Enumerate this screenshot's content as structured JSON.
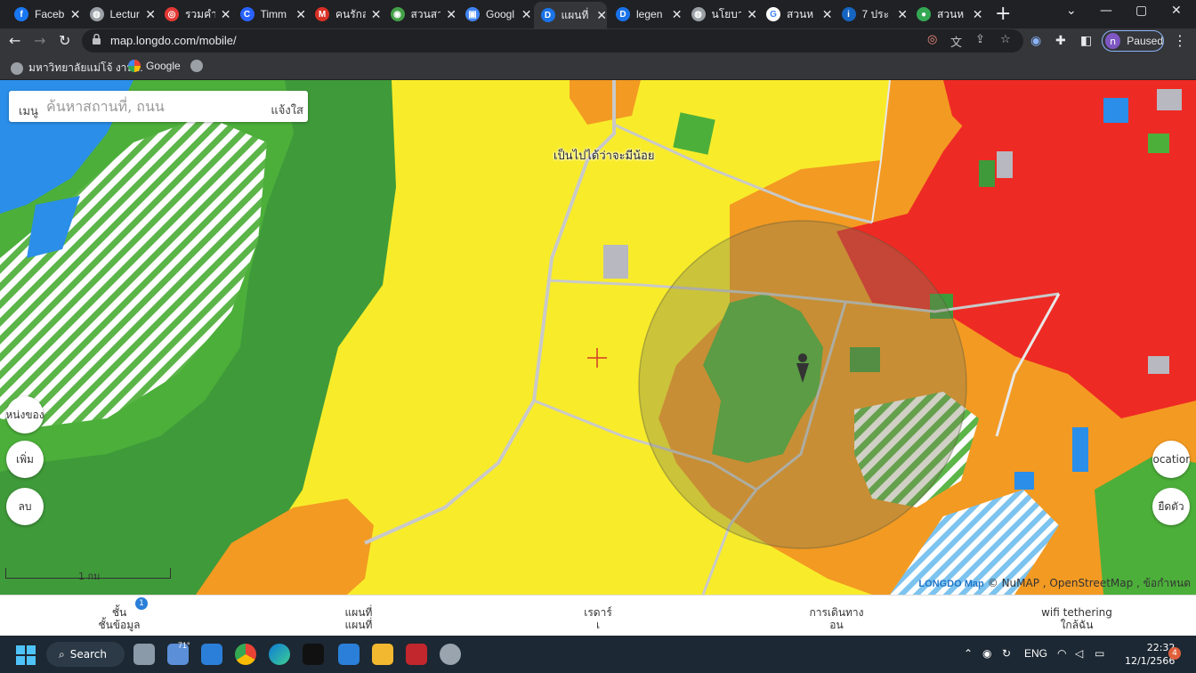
{
  "tabs": [
    {
      "title": "Faceb",
      "favicon": "facebook-icon",
      "color": "#1877f2",
      "glyph": "f"
    },
    {
      "title": "Lectur",
      "favicon": "globe-icon",
      "color": "#9aa0a6",
      "glyph": "◍"
    },
    {
      "title": "รวมคำ",
      "favicon": "target-icon",
      "color": "#e53935",
      "glyph": "◎"
    },
    {
      "title": "Timm",
      "favicon": "timm-icon",
      "color": "#2962ff",
      "glyph": "C"
    },
    {
      "title": "คนรักส",
      "favicon": "gmail-icon",
      "color": "#d93025",
      "glyph": "M"
    },
    {
      "title": "สวนสา",
      "favicon": "site-icon",
      "color": "#43a047",
      "glyph": "◉"
    },
    {
      "title": "Googl",
      "favicon": "google-slides-icon",
      "color": "#4285f4",
      "glyph": "▣"
    },
    {
      "title": "แผนที่",
      "favicon": "doc-icon",
      "color": "#1a73e8",
      "glyph": "D"
    },
    {
      "title": "legen",
      "favicon": "doc-icon",
      "color": "#1a73e8",
      "glyph": "D"
    },
    {
      "title": "นโยบาย",
      "favicon": "globe-icon",
      "color": "#9aa0a6",
      "glyph": "◍"
    },
    {
      "title": "สวนห",
      "favicon": "google-icon",
      "color": "#ffffff",
      "glyph": "G"
    },
    {
      "title": "7 ประ",
      "favicon": "info-icon",
      "color": "#1565c0",
      "glyph": "i"
    },
    {
      "title": "สวนห",
      "favicon": "maps-pin-icon",
      "color": "#34a853",
      "glyph": "●"
    }
  ],
  "active_tab_index": 7,
  "address": {
    "url": "map.longdo.com/mobile/"
  },
  "bookmarks": [
    {
      "label": "มหาวิทยาลัยแม่โจ้ งาน...",
      "icon": "globe-icon"
    },
    {
      "label": "Google",
      "icon": "google-icon"
    },
    {
      "label": "",
      "icon": "globe-icon"
    }
  ],
  "profile": {
    "initial": "n",
    "label": "Paused"
  },
  "map": {
    "search_menu": "เมนู",
    "search_placeholder": "ค้นหาสถานที่, ถนน",
    "report_label": "แจ้งใส",
    "place_label": "เป็นไปได้ว่าจะมีน้อย",
    "left_buttons": [
      "หน่งของ",
      "เพิ่ม",
      "ลบ"
    ],
    "right_buttons": [
      "location",
      "ยืดตัว"
    ],
    "scale_label": "1 กม",
    "attribution_logo": "LONGDO Map",
    "attribution_text": "© NuMAP , OpenStreetMap , ข้อกำหนด",
    "colors": {
      "yellow": "#f8ec2a",
      "orange": "#f39a22",
      "red": "#ee2a24",
      "green": "#4caf3a",
      "darkgreen": "#3f9a3a",
      "blue": "#2b8ee8",
      "gray": "#b8b8c0"
    }
  },
  "appbar": [
    {
      "line1": "ชั้น",
      "line2": "ชั้นข้อมูล",
      "badge": "1"
    },
    {
      "line1": "แผนที่",
      "line2": "แผนที่",
      "badge": ""
    },
    {
      "line1": "เรดาร์",
      "line2": "เ",
      "badge": ""
    },
    {
      "line1": "การเดินทาง",
      "line2": "อน",
      "badge": ""
    },
    {
      "line1": "wifi tethering",
      "line2": "ใกล้ฉัน",
      "badge": ""
    }
  ],
  "taskbar": {
    "search_label": "Search",
    "weather": "71°",
    "lang": "ENG",
    "time": "22:32",
    "date": "12/1/2566",
    "notifications": "4"
  }
}
